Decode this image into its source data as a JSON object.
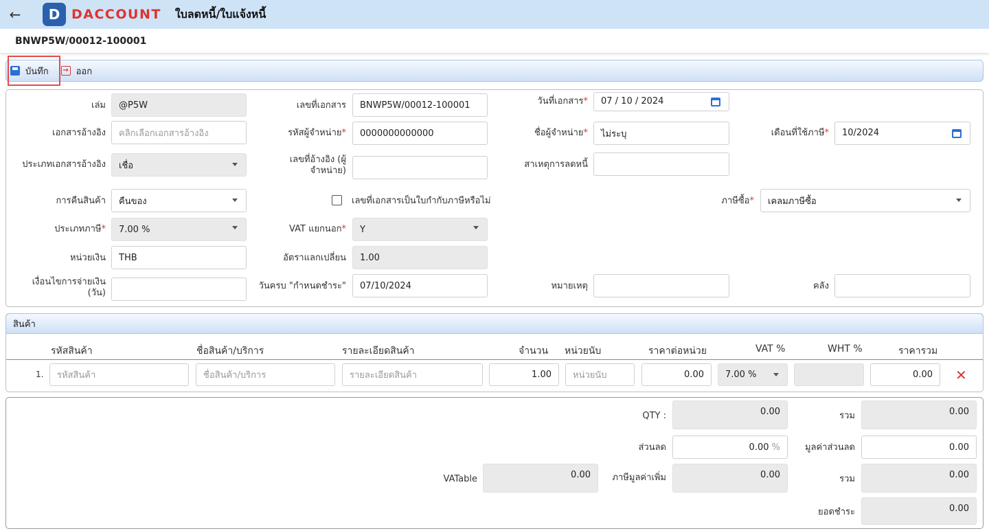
{
  "header": {
    "back_icon": "arrow-left-icon",
    "logo_letter": "D",
    "logo_text": "DACCOUNT",
    "title": "ใบลดหนี้/ใบแจ้งหนี้"
  },
  "doc_number": "BNWP5W/00012-100001",
  "toolbar": {
    "save_label": "บันทึก",
    "exit_label": "ออก"
  },
  "form": {
    "book_label": "เล่ม",
    "book_value": "@P5W",
    "docno_label": "เลขที่เอกสาร",
    "docno_value": "BNWP5W/00012-100001",
    "docdate_label": "วันที่เอกสาร",
    "docdate_value": "07 / 10 /  2024",
    "refdoc_label": "เอกสารอ้างอิง",
    "refdoc_placeholder": "คลิกเลือกเอกสารอ้างอิง",
    "vendorcode_label": "รหัสผู้จำหน่าย",
    "vendorcode_value": "0000000000000",
    "vendorname_label": "ชื่อผู้จำหน่าย",
    "vendorname_value": "ไม่ระบุ",
    "taxmonth_label": "เดือนที่ใช้ภาษี",
    "taxmonth_value": "10/2024",
    "reftype_label": "ประเภทเอกสารอ้างอิง",
    "reftype_value": "เชื่อ",
    "vendorref_label_1": "เลขที่อ้างอิง (ผู้",
    "vendorref_label_2": "จำหน่าย)",
    "vendorref_value": "",
    "reason_label": "สาเหตุการลดหนี้",
    "reason_value": "",
    "return_label": "การคืนสินค้า",
    "return_value": "คืนของ",
    "taxinvoice_check_label": "เลขที่เอกสารเป็นใบกำกับภาษีหรือไม่",
    "purchasetax_label": "ภาษีซื้อ",
    "purchasetax_value": "เคลมภาษีซื้อ",
    "taxtype_label": "ประเภทภาษี",
    "taxtype_value": "7.00 %",
    "vatsep_label": "VAT แยกนอก",
    "vatsep_value": "Y",
    "currency_label": "หน่วยเงิน",
    "currency_value": "THB",
    "rate_label": "อัตราแลกเปลี่ยน",
    "rate_value": "1.00",
    "payterm_label_1": "เงื่อนไขการจ่ายเงิน",
    "payterm_label_2": "(วัน)",
    "payterm_value": "",
    "duedate_label": "วันครบ \"กำหนดชำระ\"",
    "duedate_value": "07/10/2024",
    "note_label": "หมายเหตุ",
    "note_value": "",
    "warehouse_label": "คลัง",
    "warehouse_value": ""
  },
  "products": {
    "title": "สินค้า",
    "columns": [
      "รหัสสินค้า",
      "ชื่อสินค้า/บริการ",
      "รายละเอียดสินค้า",
      "จำนวน",
      "หน่วยนับ",
      "ราคาต่อหน่วย",
      "VAT %",
      "WHT %",
      "ราคารวม"
    ],
    "row": {
      "num": "1.",
      "code_placeholder": "รหัสสินค้า",
      "name_placeholder": "ชื่อสินค้า/บริการ",
      "detail_placeholder": "รายละเอียดสินค้า",
      "qty": "1.00",
      "unit_placeholder": "หน่วยนับ",
      "price": "0.00",
      "vat": "7.00 %",
      "wht": "",
      "total": "0.00",
      "delete_icon": "close-icon"
    }
  },
  "summary": {
    "qty_label": "QTY :",
    "qty_value": "0.00",
    "sum_label": "รวม",
    "sum_value": "0.00",
    "discount_label": "ส่วนลด",
    "discount_value": "0.00",
    "discount_unit": "%",
    "discount_amount_label": "มูลค่าส่วนลด",
    "discount_amount_value": "0.00",
    "vatable_label": "VATable",
    "vatable_value": "0.00",
    "vat_label": "ภาษีมูลค่าเพิ่ม",
    "vat_value": "0.00",
    "sum2_label": "รวม",
    "sum2_value": "0.00",
    "grand_label": "ยอดชำระ",
    "grand_value": "0.00"
  },
  "colors": {
    "topbar": "#cfe3f7",
    "brand_red": "#e0322f",
    "brand_blue": "#2a60ad"
  }
}
